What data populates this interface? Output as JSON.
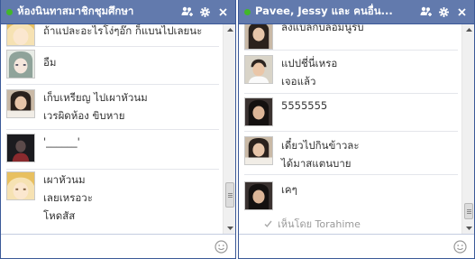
{
  "colors": {
    "titlebar": "#627aad",
    "border": "#3b5998",
    "online": "#42b72a"
  },
  "left_window": {
    "title": "ห้องนินทาสมาชิกชุมศึกษา",
    "icons": [
      "add-friends-icon",
      "gear-icon",
      "close-icon"
    ],
    "messages": [
      {
        "avatar": "anime-avatar-blonde",
        "lines": [
          "ถ้าแปละอะไรโง่ๆอ๊ก ก็แบนไปเลยนะ"
        ]
      },
      {
        "avatar": "anime-avatar-green-hair",
        "lines": [
          "อืม"
        ]
      },
      {
        "avatar": "photo-avatar-girl",
        "lines": [
          "เก็บเหรียญ ไปเผาหัวนม",
          "เวรผิดห้อง ขิบหาย"
        ]
      },
      {
        "avatar": "photo-avatar-dark",
        "lines": [
          "'______'"
        ]
      },
      {
        "avatar": "anime-avatar-blonde",
        "lines": [
          "เผาหัวนม",
          "เลยเหรอวะ",
          "โหดสัส"
        ]
      }
    ]
  },
  "right_window": {
    "title": "Pavee, Jessy และ คนอื่น...",
    "icons": [
      "add-friends-icon",
      "gear-icon",
      "close-icon"
    ],
    "messages": [
      {
        "avatar": "photo-avatar-girl",
        "lines": [
          "ลงแบลกบลอมนูรบ"
        ]
      },
      {
        "avatar": "photo-avatar-boy",
        "lines": [
          "แปปชี่นี่เหรอ",
          "เจอแล้ว"
        ]
      },
      {
        "avatar": "photo-avatar-dark-hair",
        "lines": [
          "5555555"
        ]
      },
      {
        "avatar": "photo-avatar-girl",
        "lines": [
          "เดี๋ยวไปกินข้าวละ",
          "ได้มาสแตนบาย"
        ]
      },
      {
        "avatar": "photo-avatar-dark-hair",
        "lines": [
          "เคๆ"
        ]
      }
    ],
    "seen_text": "เห็นโดย Torahime"
  }
}
